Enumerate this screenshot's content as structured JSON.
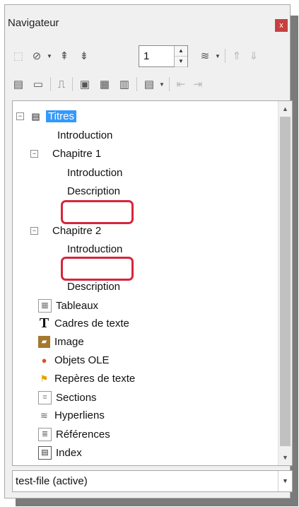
{
  "window": {
    "title": "Navigateur",
    "close_label": "x"
  },
  "toolbar1": {
    "page_number": "1"
  },
  "tree": {
    "root": "Titres",
    "items": [
      "Introduction",
      "Chapitre 1",
      "Introduction",
      "Description",
      "Chapitre 2",
      "Introduction",
      "Description"
    ],
    "categories": [
      "Tableaux",
      "Cadres de texte",
      "Image",
      "Objets OLE",
      "Repères de texte",
      "Sections",
      "Hyperliens",
      "Références",
      "Index"
    ]
  },
  "document_selector": {
    "value": "test-file (active)"
  },
  "colors": {
    "selection": "#3399ff",
    "annotation": "#d6263c",
    "close": "#c7403e"
  }
}
